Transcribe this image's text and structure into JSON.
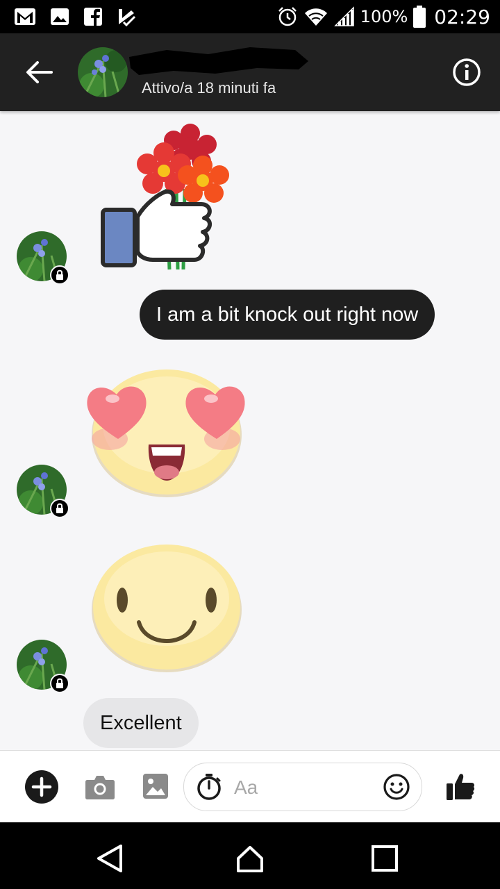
{
  "status_bar": {
    "battery": "100%",
    "time": "02:29",
    "left_icons": [
      "gmail-icon",
      "gallery-icon",
      "facebook-icon",
      "check-list-icon"
    ],
    "right_icons": [
      "alarm-icon",
      "wifi-icon",
      "signal-icon",
      "battery-icon"
    ]
  },
  "header": {
    "status": "Attivo/a 18 minuti fa",
    "back_icon": "arrow-back-icon",
    "info_icon": "info-icon"
  },
  "messages": [
    {
      "type": "sticker",
      "from": "contact",
      "sticker": "thumbs-up-flowers"
    },
    {
      "type": "text",
      "from": "me",
      "text": "I am a bit knock out right now"
    },
    {
      "type": "sticker",
      "from": "contact",
      "sticker": "heart-eyes-blob"
    },
    {
      "type": "sticker",
      "from": "contact",
      "sticker": "smile-blob"
    },
    {
      "type": "text",
      "from": "contact",
      "text": "Excellent"
    }
  ],
  "composer": {
    "placeholder": "Aa",
    "icons": [
      "plus-icon",
      "camera-icon",
      "image-icon",
      "timer-icon",
      "emoji-icon",
      "like-icon"
    ]
  },
  "colors": {
    "header_bg": "#212121",
    "outgoing_bubble": "#1f1f1f",
    "incoming_bubble": "#e6e6e8",
    "chat_bg": "#f6f6f8"
  }
}
